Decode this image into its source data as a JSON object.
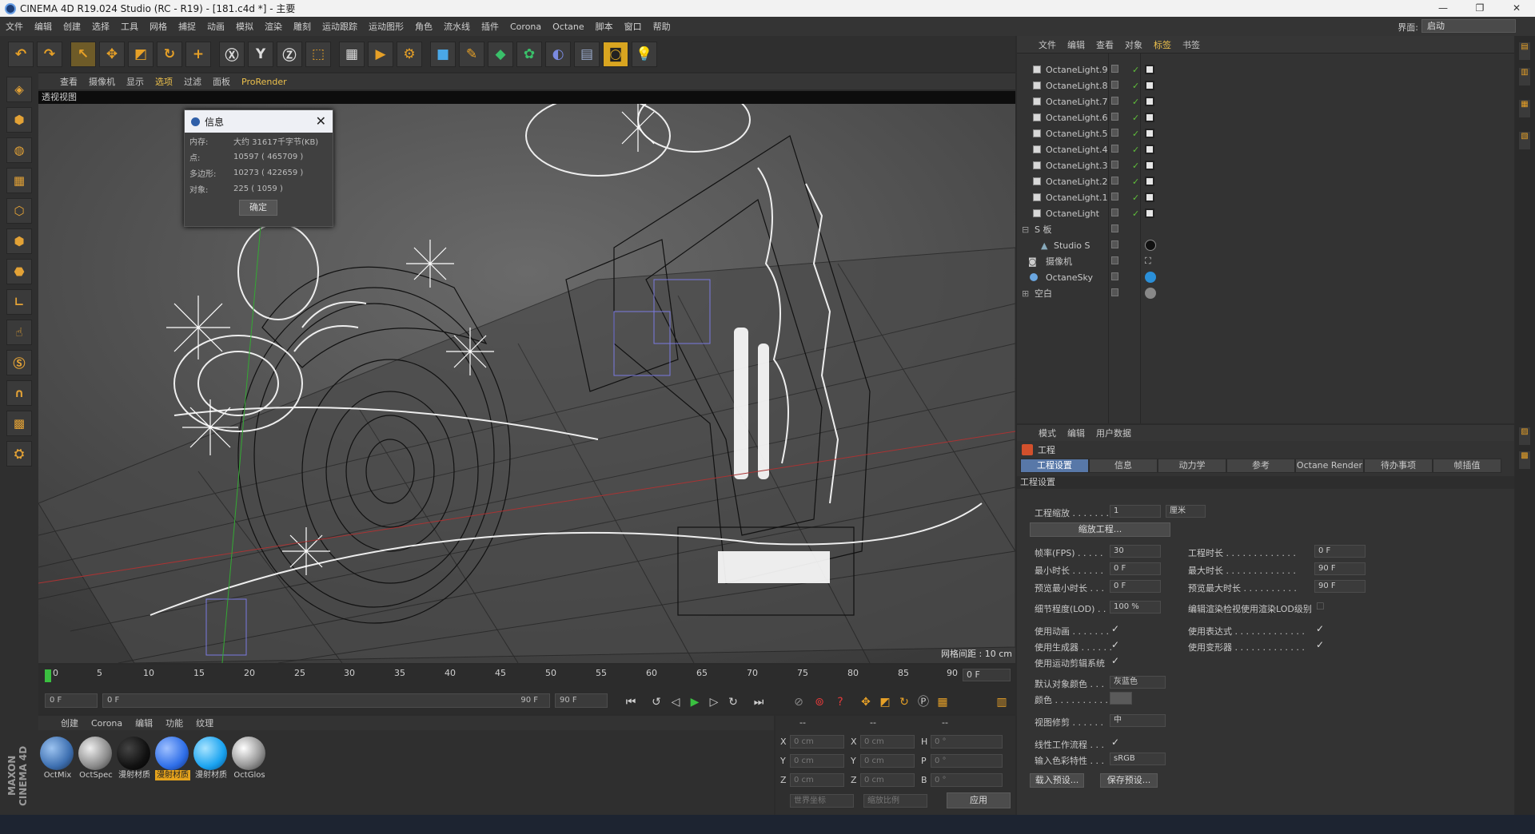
{
  "window": {
    "title": "CINEMA 4D R19.024 Studio (RC - R19) - [181.c4d *] - 主要",
    "controls": [
      "—",
      "❐",
      "✕"
    ]
  },
  "menubar": {
    "items": [
      "文件",
      "编辑",
      "创建",
      "选择",
      "工具",
      "网格",
      "捕捉",
      "动画",
      "模拟",
      "渲染",
      "雕刻",
      "运动跟踪",
      "运动图形",
      "角色",
      "流水线",
      "插件",
      "Corona",
      "Octane",
      "脚本",
      "窗口",
      "帮助"
    ],
    "layout_label": "界面:",
    "layout_value": "启动"
  },
  "viewport": {
    "menu": [
      "查看",
      "摄像机",
      "显示",
      "选项",
      "过滤",
      "面板",
      "ProRender"
    ],
    "header": "透视视图",
    "grid_info": "网格间距 : 10 cm"
  },
  "info_dialog": {
    "title": "信息",
    "rows": [
      {
        "k": "内存:",
        "v": "大约 31617千字节(KB)"
      },
      {
        "k": "点:",
        "v": "10597 ( 465709 )"
      },
      {
        "k": "多边形:",
        "v": "10273 ( 422659 )"
      },
      {
        "k": "对象:",
        "v": "225 ( 1059 )"
      }
    ],
    "ok": "确定"
  },
  "timeline": {
    "ticks": [
      "0",
      "5",
      "10",
      "15",
      "20",
      "25",
      "30",
      "35",
      "40",
      "45",
      "50",
      "55",
      "60",
      "65",
      "70",
      "75",
      "80",
      "85",
      "90"
    ],
    "frame": "0 F"
  },
  "playbar": {
    "start": "0 F",
    "range_start": "0 F",
    "range_end": "90 F",
    "end": "90 F"
  },
  "materials": {
    "menu": [
      "创建",
      "Corona",
      "编辑",
      "功能",
      "纹理"
    ],
    "items": [
      {
        "label": "OctMix",
        "color": "#3d6fb0",
        "active": false
      },
      {
        "label": "OctSpec",
        "color": "#8a8a8a",
        "active": false
      },
      {
        "label": "漫射材质",
        "color": "#111111",
        "active": false
      },
      {
        "label": "漫射材质",
        "color": "#2f6fe8",
        "active": true
      },
      {
        "label": "漫射材质",
        "color": "#1aa3f0",
        "active": false
      },
      {
        "label": "OctGlos",
        "color": "#9a9a9a",
        "active": false
      }
    ]
  },
  "coords": {
    "headers": [
      "--",
      "--",
      "--"
    ],
    "rows": [
      {
        "a": "X",
        "av": "0 cm",
        "b": "X",
        "bv": "0 cm",
        "c": "H",
        "cv": "0 °"
      },
      {
        "a": "Y",
        "av": "0 cm",
        "b": "Y",
        "bv": "0 cm",
        "c": "P",
        "cv": "0 °"
      },
      {
        "a": "Z",
        "av": "0 cm",
        "b": "Z",
        "bv": "0 cm",
        "c": "B",
        "cv": "0 °"
      }
    ],
    "world": "世界坐标",
    "scale": "缩放比例",
    "apply": "应用"
  },
  "objects": {
    "menu": [
      "文件",
      "编辑",
      "查看",
      "对象",
      "标签",
      "书签"
    ],
    "items": [
      "OctaneLight.9",
      "OctaneLight.8",
      "OctaneLight.7",
      "OctaneLight.6",
      "OctaneLight.5",
      "OctaneLight.4",
      "OctaneLight.3",
      "OctaneLight.2",
      "OctaneLight.1",
      "OctaneLight",
      "S 板",
      "Studio S",
      "摄像机",
      "OctaneSky",
      "空白"
    ]
  },
  "attributes": {
    "menu": [
      "模式",
      "编辑",
      "用户数据"
    ],
    "title": "工程",
    "tabs": [
      "工程设置",
      "信息",
      "动力学",
      "参考",
      "Octane Render",
      "待办事项",
      "帧插值"
    ],
    "section": "工程设置",
    "scale_label": "工程缩放 . . . . . . .",
    "scale_value": "1",
    "scale_unit": "厘米",
    "scale_btn": "缩放工程...",
    "fps_label": "帧率(FPS) . . . . .",
    "fps": "30",
    "dur_label": "工程时长 . . . . . . . . . . . . .",
    "dur": "0 F",
    "min_label": "最小时长 . . . . . .",
    "min": "0 F",
    "max_label": "最大时长 . . . . . . . . . . . . .",
    "max": "90 F",
    "pmin_label": "预览最小时长 . . .",
    "pmin": "0 F",
    "pmax_label": "预览最大时长 . . . . . . . . . .",
    "pmax": "90 F",
    "lod_label": "细节程度(LOD) . . .",
    "lod": "100 %",
    "lod2_label": "编辑渲染检视使用渲染LOD级别",
    "anim_label": "使用动画 . . . . . . .",
    "expr_label": "使用表达式 . . . . . . . . . . . . .",
    "gen_label": "使用生成器 . . . . . .",
    "def_label": "使用变形器 . . . . . . . . . . . . .",
    "mo_label": "使用运动剪辑系统",
    "color_label": "默认对象颜色 . . .",
    "color_value": "灰蓝色",
    "col_label": "颜色 . . . . . . . . . . .",
    "clip_label": "视图修剪 . . . . . .",
    "clip_value": "中",
    "lin_label": "线性工作流程 . . .",
    "icp_label": "输入色彩特性 . . .",
    "icp_value": "sRGB",
    "load": "载入预设...",
    "save": "保存预设..."
  }
}
